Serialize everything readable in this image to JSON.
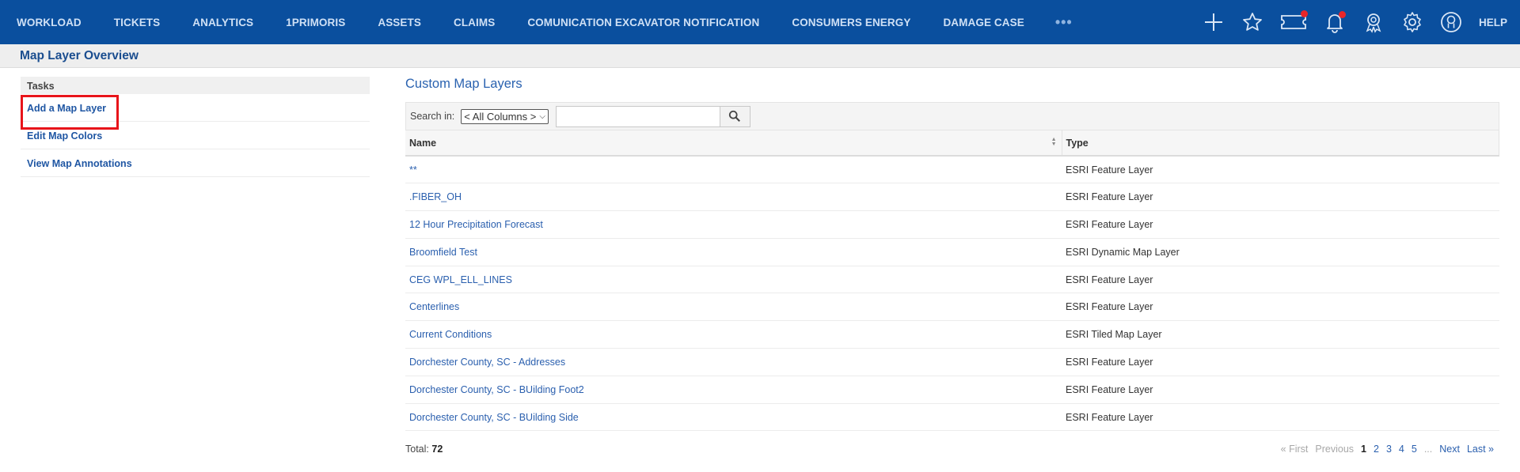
{
  "nav": {
    "items": [
      "WORKLOAD",
      "TICKETS",
      "ANALYTICS",
      "1PRIMORIS",
      "ASSETS",
      "CLAIMS",
      "COMUNICATION EXCAVATOR NOTIFICATION",
      "CONSUMERS ENERGY",
      "DAMAGE CASE"
    ],
    "more": "•••",
    "help": "HELP",
    "icons": [
      "plus-icon",
      "star-icon",
      "ticket-icon",
      "bell-icon",
      "award-icon",
      "gear-icon",
      "user-icon"
    ]
  },
  "page": {
    "title": "Map Layer Overview"
  },
  "tasks": {
    "header": "Tasks",
    "items": [
      "Add a Map Layer",
      "Edit Map Colors",
      "View Map Annotations"
    ]
  },
  "main": {
    "title": "Custom Map Layers",
    "search_label": "Search in:",
    "search_select": "< All Columns >",
    "search_placeholder": "",
    "columns": [
      "Name",
      "Type"
    ],
    "rows": [
      {
        "name": "**",
        "type": "ESRI Feature Layer"
      },
      {
        "name": ".FIBER_OH",
        "type": "ESRI Feature Layer"
      },
      {
        "name": "12 Hour Precipitation Forecast",
        "type": "ESRI Feature Layer"
      },
      {
        "name": "Broomfield Test",
        "type": "ESRI Dynamic Map Layer"
      },
      {
        "name": "CEG WPL_ELL_LINES",
        "type": "ESRI Feature Layer"
      },
      {
        "name": "Centerlines",
        "type": "ESRI Feature Layer"
      },
      {
        "name": "Current Conditions",
        "type": "ESRI Tiled Map Layer"
      },
      {
        "name": "Dorchester County, SC - Addresses",
        "type": "ESRI Feature Layer"
      },
      {
        "name": "Dorchester County, SC - BUilding Foot2",
        "type": "ESRI Feature Layer"
      },
      {
        "name": "Dorchester County, SC - BUilding Side",
        "type": "ESRI Feature Layer"
      }
    ],
    "total_label": "Total:",
    "total_value": "72",
    "pager": {
      "first": "« First",
      "previous": "Previous",
      "pages": [
        "1",
        "2",
        "3",
        "4",
        "5"
      ],
      "ellipsis": "...",
      "next": "Next",
      "last": "Last »"
    }
  },
  "colors": {
    "nav_bg": "#0a4f9e",
    "link": "#2a5fae",
    "highlight": "#e8141a",
    "notification": "#e8262a"
  }
}
